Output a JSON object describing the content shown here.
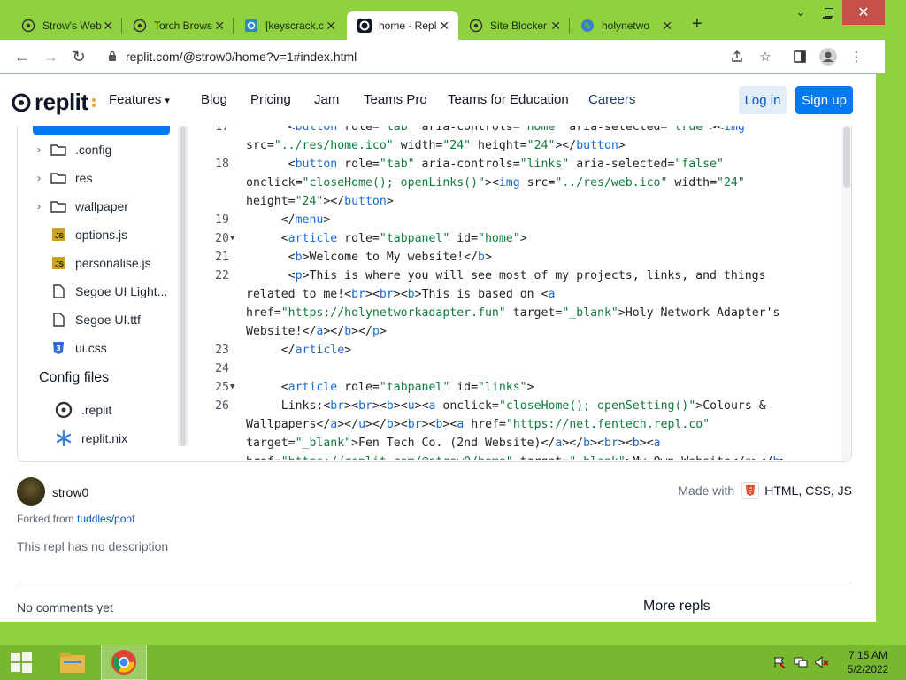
{
  "browser": {
    "tabs": [
      {
        "title": "Strow's Web",
        "active": false
      },
      {
        "title": "Torch Brows",
        "active": false
      },
      {
        "title": "[keyscrack.c",
        "active": false
      },
      {
        "title": "home - Repl",
        "active": true
      },
      {
        "title": "Site Blocker",
        "active": false
      },
      {
        "title": "holynetwo",
        "active": false
      }
    ],
    "new_tab": "+",
    "address": "replit.com/@strow0/home?v=1#index.html"
  },
  "header": {
    "logo": "replit",
    "nav": [
      "Features",
      "Blog",
      "Pricing",
      "Jam",
      "Teams Pro",
      "Teams for Education",
      "Careers"
    ],
    "login": "Log in",
    "signup": "Sign up"
  },
  "files": {
    "items": [
      {
        "name": ".config",
        "type": "folder"
      },
      {
        "name": "res",
        "type": "folder"
      },
      {
        "name": "wallpaper",
        "type": "folder"
      },
      {
        "name": "options.js",
        "type": "js"
      },
      {
        "name": "personalise.js",
        "type": "js"
      },
      {
        "name": "Segoe UI Light...",
        "type": "file"
      },
      {
        "name": "Segoe UI.ttf",
        "type": "file"
      },
      {
        "name": "ui.css",
        "type": "css"
      }
    ],
    "config_title": "Config files",
    "config": [
      {
        "name": ".replit"
      },
      {
        "name": "replit.nix"
      }
    ],
    "js_badge": "JS"
  },
  "editor": {
    "lines": [
      {
        "n": "17",
        "fold": false,
        "text": "      <button role=\"tab\" aria-controls=\"home\" aria-selected=\"true\"><img\nsrc=\"../res/home.ico\" width=\"24\" height=\"24\"></button>"
      },
      {
        "n": "18",
        "fold": false,
        "text": "      <button role=\"tab\" aria-controls=\"links\" aria-selected=\"false\"\nonclick=\"closeHome(); openLinks()\"><img src=\"../res/web.ico\" width=\"24\"\nheight=\"24\"></button>"
      },
      {
        "n": "19",
        "fold": false,
        "text": "     </menu>"
      },
      {
        "n": "20",
        "fold": true,
        "text": "     <article role=\"tabpanel\" id=\"home\">"
      },
      {
        "n": "21",
        "fold": false,
        "text": "      <b>Welcome to My website!</b>"
      },
      {
        "n": "22",
        "fold": false,
        "text": "      <p>This is where you will see most of my projects, links, and things\nrelated to me!<br><br><b>This is based on <a\nhref=\"https://holynetworkadapter.fun\" target=\"_blank\">Holy Network Adapter's\nWebsite!</a></b></p>"
      },
      {
        "n": "23",
        "fold": false,
        "text": "     </article>"
      },
      {
        "n": "24",
        "fold": false,
        "text": ""
      },
      {
        "n": "25",
        "fold": true,
        "text": "     <article role=\"tabpanel\" id=\"links\">"
      },
      {
        "n": "26",
        "fold": false,
        "text": "     Links:<br><br><b><u><a onclick=\"closeHome(); openSetting()\">Colours &\nWallpapers</a></u></b><br><b><a href=\"https://net.fentech.repl.co\"\ntarget=\"_blank\">Fen Tech Co. (2nd Website)</a></b><br><b><a\nhref=\"https://replit.com/@strow0/home\" target=\"_blank\">My Own Website</a></b>"
      }
    ]
  },
  "meta": {
    "owner": "strow0",
    "made_with_label": "Made with",
    "languages": "HTML, CSS, JS",
    "forked_prefix": "Forked from ",
    "forked_link": "tuddles/poof",
    "description": "This repl has no description",
    "comments": "No comments yet",
    "more_repls": "More repls"
  },
  "taskbar": {
    "time": "7:15 AM",
    "date": "5/2/2022"
  },
  "colors": {
    "accent": "#0079f2",
    "window_frame": "#8fd13f",
    "taskbar": "#78b82f"
  }
}
